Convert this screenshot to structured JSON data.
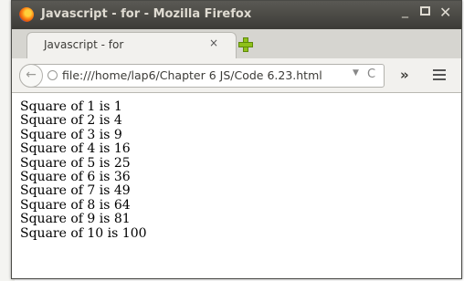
{
  "window": {
    "title": "Javascript - for - Mozilla Firefox",
    "controls": {
      "minimize": "_",
      "close": "✕"
    }
  },
  "tab": {
    "label": "Javascript - for",
    "close_glyph": "×"
  },
  "navigation": {
    "url": "file:///home/lap6/Chapter 6 JS/Code 6.23.html",
    "back_glyph": "←",
    "dropdown_glyph": "▼",
    "reload_glyph": "C",
    "overflow_glyph": "»"
  },
  "output_lines": [
    "Square of 1 is 1",
    "Square of 2 is 4",
    "Square of 3 is 9",
    "Square of 4 is 16",
    "Square of 5 is 25",
    "Square of 6 is 36",
    "Square of 7 is 49",
    "Square of 8 is 64",
    "Square of 9 is 81",
    "Square of 10 is 100"
  ],
  "icons": [
    "firefox-logo-icon",
    "close-tab-icon",
    "new-tab-icon",
    "back-arrow-icon",
    "globe-icon",
    "dropdown-icon",
    "reload-icon",
    "overflow-icon",
    "hamburger-menu-icon",
    "minimize-icon",
    "maximize-icon",
    "close-window-icon"
  ],
  "colors": {
    "titlebar": "#3c3b37",
    "titlebar_text": "#dfdbd2",
    "new_tab_plus": "#8fc11b"
  }
}
